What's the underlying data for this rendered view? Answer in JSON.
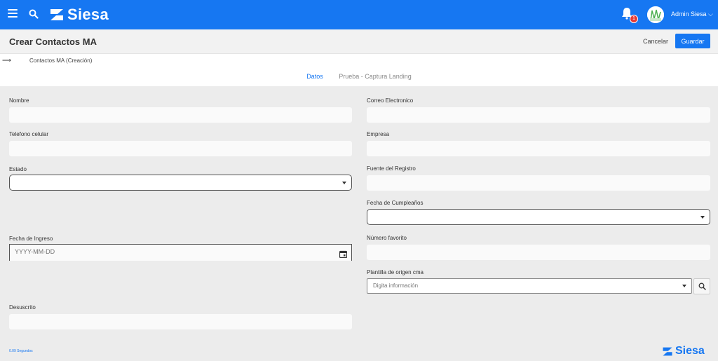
{
  "topbar": {
    "brand": "Siesa",
    "notifications_count": "1",
    "user_label": "Admin Siesa ⌵"
  },
  "header": {
    "title": "Crear Contactos MA",
    "cancel_label": "Cancelar",
    "save_label": "Guardar"
  },
  "breadcrumb": {
    "back_glyph": "⟶",
    "text": "Contactos MA (Creación)"
  },
  "tabs": [
    {
      "label": "Datos",
      "active": true
    },
    {
      "label": "Prueba - Captura Landing",
      "active": false
    }
  ],
  "form": {
    "nombre": {
      "label": "Nombre",
      "value": ""
    },
    "correo": {
      "label": "Correo Electronico",
      "value": ""
    },
    "telefono": {
      "label": "Telefono celular",
      "value": ""
    },
    "empresa": {
      "label": "Empresa",
      "value": ""
    },
    "estado": {
      "label": "Estado",
      "value": ""
    },
    "fuente": {
      "label": "Fuente del Registro",
      "value": ""
    },
    "cumpleanos": {
      "label": "Fecha de Cumpleaños",
      "value": ""
    },
    "ingreso": {
      "label": "Fecha de Ingreso",
      "placeholder": "YYYY-MM-DD"
    },
    "numero_favorito": {
      "label": "Número favorito",
      "value": ""
    },
    "plantilla": {
      "label": "Plantilla de origen cma",
      "placeholder": "Digita información"
    },
    "desuscrito": {
      "label": "Desuscrito",
      "value": ""
    }
  },
  "footer": {
    "time": "0.09 Segundos",
    "brand": "Siesa"
  },
  "colors": {
    "primary": "#1677f2",
    "background": "#ececec"
  }
}
